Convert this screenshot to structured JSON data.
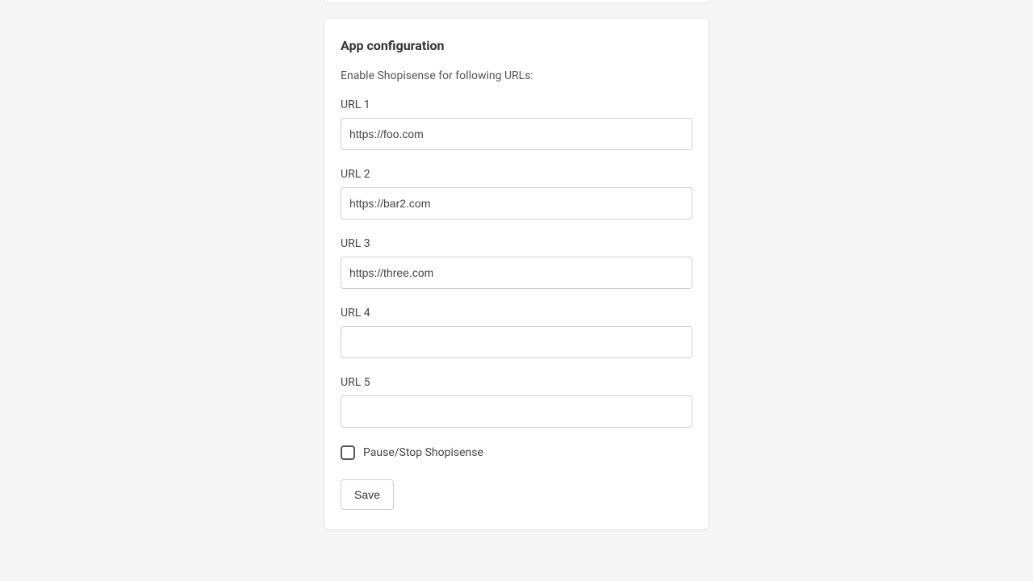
{
  "card": {
    "title": "App configuration",
    "description": "Enable Shopisense for following URLs:",
    "fields": [
      {
        "label": "URL 1",
        "value": "https://foo.com"
      },
      {
        "label": "URL 2",
        "value": "https://bar2.com"
      },
      {
        "label": "URL 3",
        "value": "https://three.com"
      },
      {
        "label": "URL 4",
        "value": ""
      },
      {
        "label": "URL 5",
        "value": ""
      }
    ],
    "pause_label": "Pause/Stop Shopisense",
    "save_label": "Save"
  }
}
